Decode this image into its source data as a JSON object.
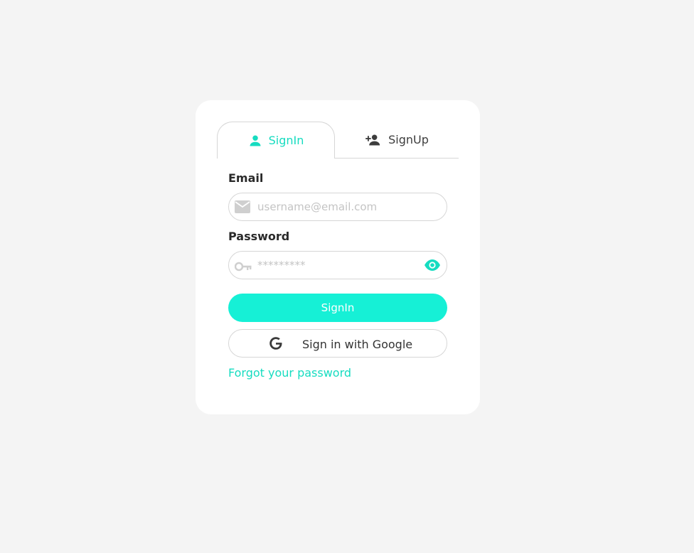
{
  "tabs": [
    {
      "label": "SignIn",
      "icon": "person-icon",
      "active": true
    },
    {
      "label": "SignUp",
      "icon": "person-add-icon",
      "active": false
    }
  ],
  "email": {
    "label": "Email",
    "placeholder": "username@email.com",
    "icon": "envelope-icon"
  },
  "password": {
    "label": "Password",
    "placeholder": "*********",
    "icon": "key-icon",
    "toggle_icon": "eye-icon"
  },
  "buttons": {
    "signin": "SignIn",
    "google": "Sign in with Google"
  },
  "forgot_link": "Forgot your password",
  "colors": {
    "accent": "#16dcc0",
    "button": "#16f0d6",
    "background": "#f4f4f4",
    "card": "#ffffff",
    "border": "#d6d6d6"
  }
}
